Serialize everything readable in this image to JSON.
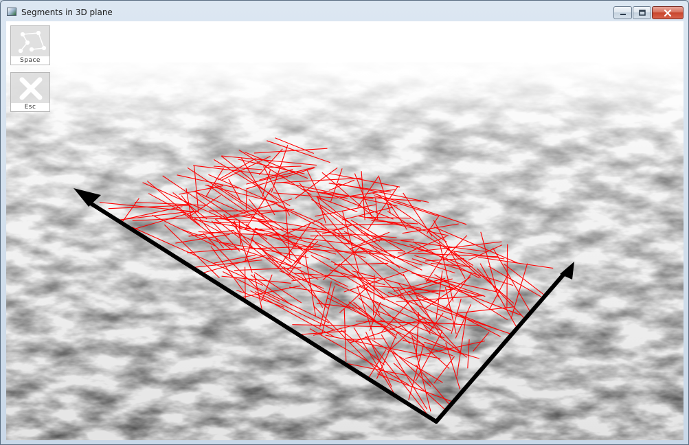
{
  "window": {
    "title": "Segments in 3D plane"
  },
  "toolbar": {
    "space_label": "Space",
    "esc_label": "Esc"
  },
  "icons": {
    "app": "app-window-icon",
    "minimize": "minimize-icon",
    "maximize": "restore-icon",
    "close": "close-icon",
    "space": "graph-nodes-icon",
    "esc": "x-cross-icon"
  },
  "colors": {
    "segments": "#ff0000",
    "axes": "#000000",
    "close_button": "#c8452c"
  },
  "scene": {
    "segment_count": 300
  }
}
